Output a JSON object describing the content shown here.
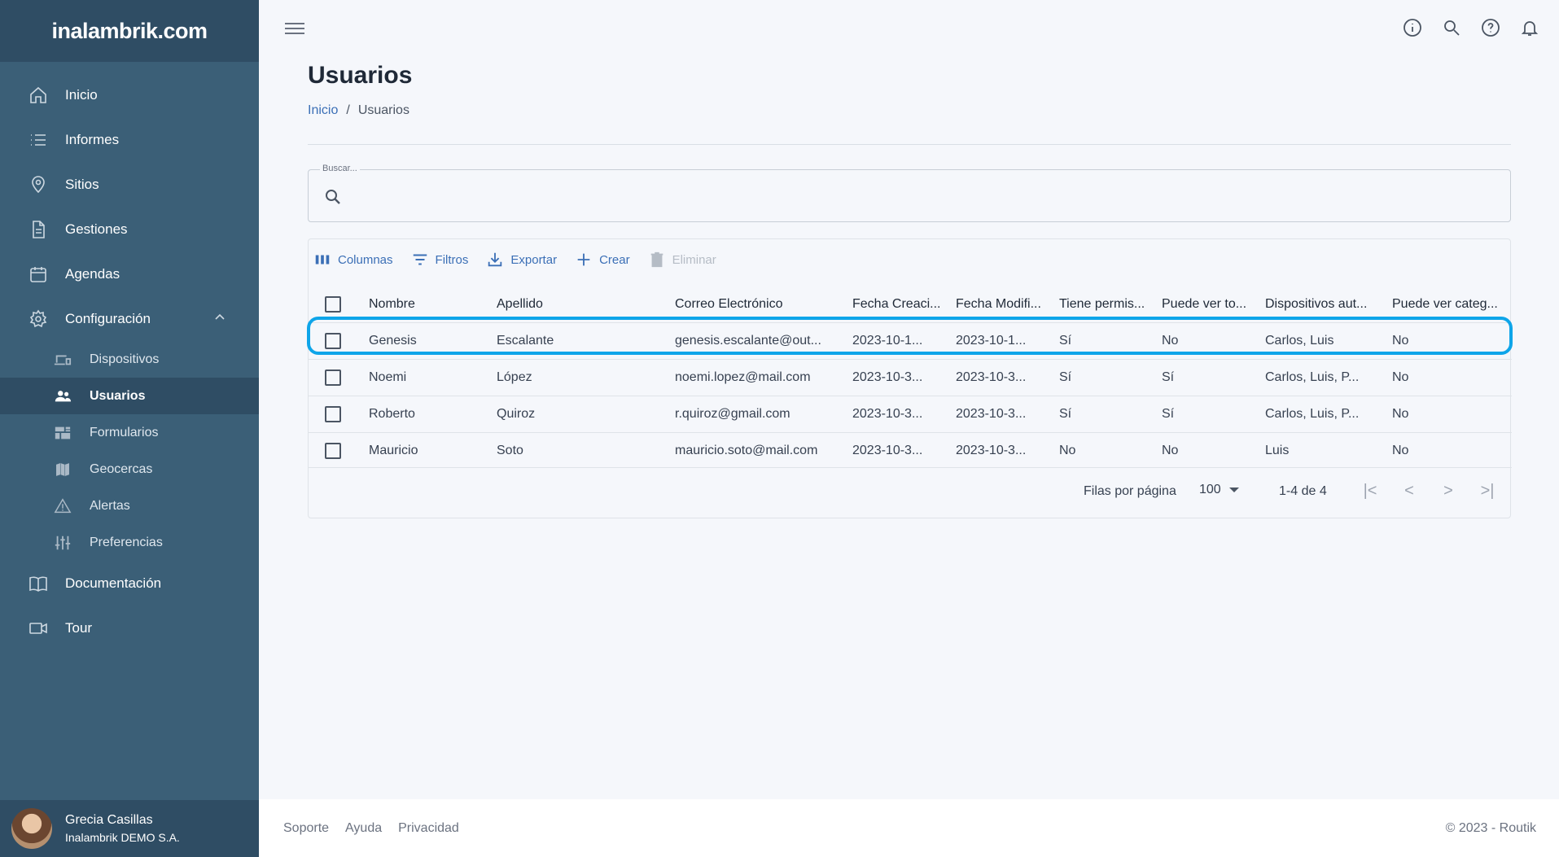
{
  "sidebar": {
    "logo": "inalambrik.com",
    "items": [
      {
        "label": "Inicio",
        "icon": "home-icon"
      },
      {
        "label": "Informes",
        "icon": "list-icon"
      },
      {
        "label": "Sitios",
        "icon": "location-icon"
      },
      {
        "label": "Gestiones",
        "icon": "document-icon"
      },
      {
        "label": "Agendas",
        "icon": "calendar-icon"
      },
      {
        "label": "Configuración",
        "icon": "gear-icon",
        "expanded": true
      }
    ],
    "subitems": [
      {
        "label": "Dispositivos",
        "icon": "devices-icon"
      },
      {
        "label": "Usuarios",
        "icon": "users-icon",
        "active": true
      },
      {
        "label": "Formularios",
        "icon": "forms-icon"
      },
      {
        "label": "Geocercas",
        "icon": "map-icon"
      },
      {
        "label": "Alertas",
        "icon": "warning-icon"
      },
      {
        "label": "Preferencias",
        "icon": "sliders-icon"
      }
    ],
    "bottom_items": [
      {
        "label": "Documentación",
        "icon": "book-icon"
      },
      {
        "label": "Tour",
        "icon": "video-icon"
      }
    ],
    "user": {
      "name": "Grecia Casillas",
      "org": "Inalambrik DEMO S.A."
    }
  },
  "header": {
    "icons": [
      "info-icon",
      "search-icon",
      "help-icon",
      "bell-icon"
    ]
  },
  "page": {
    "title": "Usuarios",
    "breadcrumb": {
      "home": "Inicio",
      "separator": "/",
      "current": "Usuarios"
    }
  },
  "search": {
    "label": "Buscar...",
    "value": ""
  },
  "toolbar": {
    "columns": "Columnas",
    "filters": "Filtros",
    "export": "Exportar",
    "create": "Crear",
    "delete": "Eliminar"
  },
  "table": {
    "columns": [
      "Nombre",
      "Apellido",
      "Correo Electrónico",
      "Fecha Creaci...",
      "Fecha Modifi...",
      "Tiene permis...",
      "Puede ver to...",
      "Dispositivos aut...",
      "Puede ver categ..."
    ],
    "rows": [
      [
        "Genesis",
        "Escalante",
        "genesis.escalante@out...",
        "2023-10-1...",
        "2023-10-1...",
        "Sí",
        "No",
        "Carlos, Luis",
        "No"
      ],
      [
        "Noemi",
        "López",
        "noemi.lopez@mail.com",
        "2023-10-3...",
        "2023-10-3...",
        "Sí",
        "Sí",
        "Carlos, Luis, P...",
        "No"
      ],
      [
        "Roberto",
        "Quiroz",
        "r.quiroz@gmail.com",
        "2023-10-3...",
        "2023-10-3...",
        "Sí",
        "Sí",
        "Carlos, Luis, P...",
        "No"
      ],
      [
        "Mauricio",
        "Soto",
        "mauricio.soto@mail.com",
        "2023-10-3...",
        "2023-10-3...",
        "No",
        "No",
        "Luis",
        "No"
      ]
    ]
  },
  "pagination": {
    "rows_label": "Filas por página",
    "rows_value": "100",
    "range": "1-4 de 4"
  },
  "footer": {
    "links": [
      "Soporte",
      "Ayuda",
      "Privacidad"
    ],
    "copyright": "© 2023 - Routik"
  },
  "colors": {
    "sidebar": "#3b5f77",
    "sidebar_dark": "#2f4d64",
    "accent": "#3b6fb6",
    "highlight": "#0ea5e9"
  }
}
